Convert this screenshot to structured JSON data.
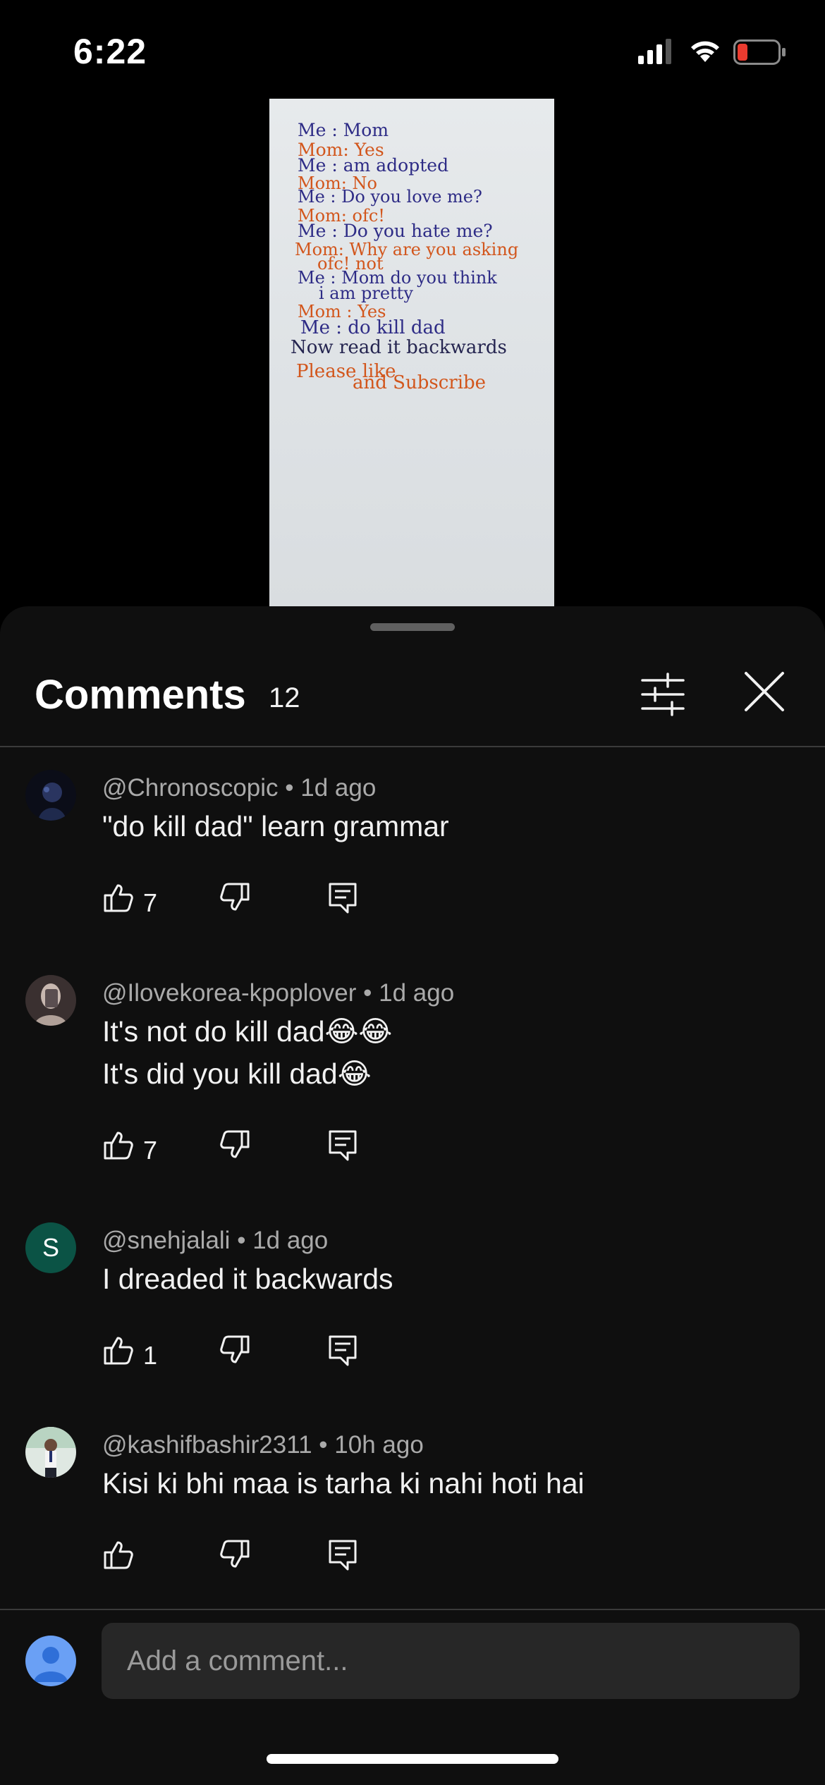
{
  "status_bar": {
    "time": "6:22"
  },
  "video": {
    "lines": [
      {
        "text": "Me : Mom",
        "color": "blue"
      },
      {
        "text": "Mom: Yes",
        "color": "orange"
      },
      {
        "text": "Me : am adopted",
        "color": "blue"
      },
      {
        "text": "Mom: No",
        "color": "orange"
      },
      {
        "text": "Me : Do you love me?",
        "color": "blue"
      },
      {
        "text": "Mom: ofc!",
        "color": "orange"
      },
      {
        "text": "Me : Do you hate me?",
        "color": "blue"
      },
      {
        "text": "Mom: Why are you asking",
        "color": "orange"
      },
      {
        "text": "ofc! not",
        "color": "orange"
      },
      {
        "text": "Me : Mom do you think",
        "color": "blue"
      },
      {
        "text": "i am pretty",
        "color": "blue"
      },
      {
        "text": "Mom : Yes",
        "color": "orange"
      },
      {
        "text": "Me : do kill dad",
        "color": "blue"
      },
      {
        "text": "Now read it backwards",
        "color": "dark"
      },
      {
        "text": "Please like",
        "color": "orange"
      },
      {
        "text": "and Subscribe",
        "color": "orange"
      }
    ]
  },
  "comments_panel": {
    "title": "Comments",
    "count": "12",
    "filter_icon": "sliders-icon",
    "close_icon": "close-icon"
  },
  "comments": [
    {
      "author": "@Chronoscopic",
      "time": "1d ago",
      "lines": [
        "\"do kill dad\" learn grammar"
      ],
      "likes": "7"
    },
    {
      "author": "@Ilovekorea-kpoplover",
      "time": "1d ago",
      "lines": [
        "It's not do kill dad😂😂",
        "It's did you kill dad😂"
      ],
      "likes": "7"
    },
    {
      "author": "@snehjalali",
      "time": "1d ago",
      "lines": [
        "I dreaded it backwards"
      ],
      "likes": "1",
      "avatar_letter": "S"
    },
    {
      "author": "@kashifbashir2311",
      "time": "10h ago",
      "lines": [
        "Kisi ki bhi maa is tarha ki nahi hoti hai"
      ],
      "likes": ""
    }
  ],
  "composer": {
    "placeholder": "Add a comment..."
  },
  "colors": {
    "sheet_bg": "#0f0f0f",
    "input_bg": "#272727",
    "secondary_text": "#aaaaaa",
    "avatar_s_bg": "#0b5345"
  }
}
